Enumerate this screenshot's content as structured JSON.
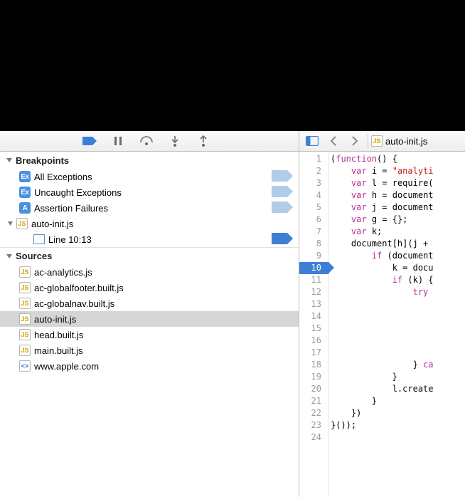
{
  "toolbar": {
    "buttons": [
      "breakpoints-toggle",
      "pause",
      "step-over",
      "step-into",
      "step-out"
    ]
  },
  "sidebar": {
    "breakpoints_header": "Breakpoints",
    "sources_header": "Sources",
    "breakpoints": [
      {
        "icon": "Ex",
        "label": "All Exceptions",
        "bp": "light"
      },
      {
        "icon": "Ex",
        "label": "Uncaught Exceptions",
        "bp": "light"
      },
      {
        "icon": "A",
        "label": "Assertion Failures",
        "bp": "light"
      }
    ],
    "breakpoint_file": {
      "name": "auto-init.js",
      "line_label": "Line 10:13",
      "bp": "active"
    },
    "sources": [
      {
        "type": "js",
        "label": "ac-analytics.js"
      },
      {
        "type": "js",
        "label": "ac-globalfooter.built.js"
      },
      {
        "type": "js",
        "label": "ac-globalnav.built.js"
      },
      {
        "type": "js",
        "label": "auto-init.js",
        "selected": true
      },
      {
        "type": "js",
        "label": "head.built.js"
      },
      {
        "type": "js",
        "label": "main.built.js"
      },
      {
        "type": "html",
        "label": "www.apple.com"
      }
    ]
  },
  "editor": {
    "filename": "auto-init.js",
    "breakpoint_line": 10,
    "lines": [
      "(function() {",
      "    var i = \"analyti",
      "    var l = require(",
      "    var h = document",
      "    var j = document",
      "    var g = {};",
      "    var k;",
      "    document[h](j + ",
      "        if (document",
      "            k = docu",
      "            if (k) {",
      "                try ",
      "",
      "",
      "",
      "",
      "",
      "                } ca",
      "            }",
      "            l.create",
      "        }",
      "    })",
      "}());",
      ""
    ]
  }
}
